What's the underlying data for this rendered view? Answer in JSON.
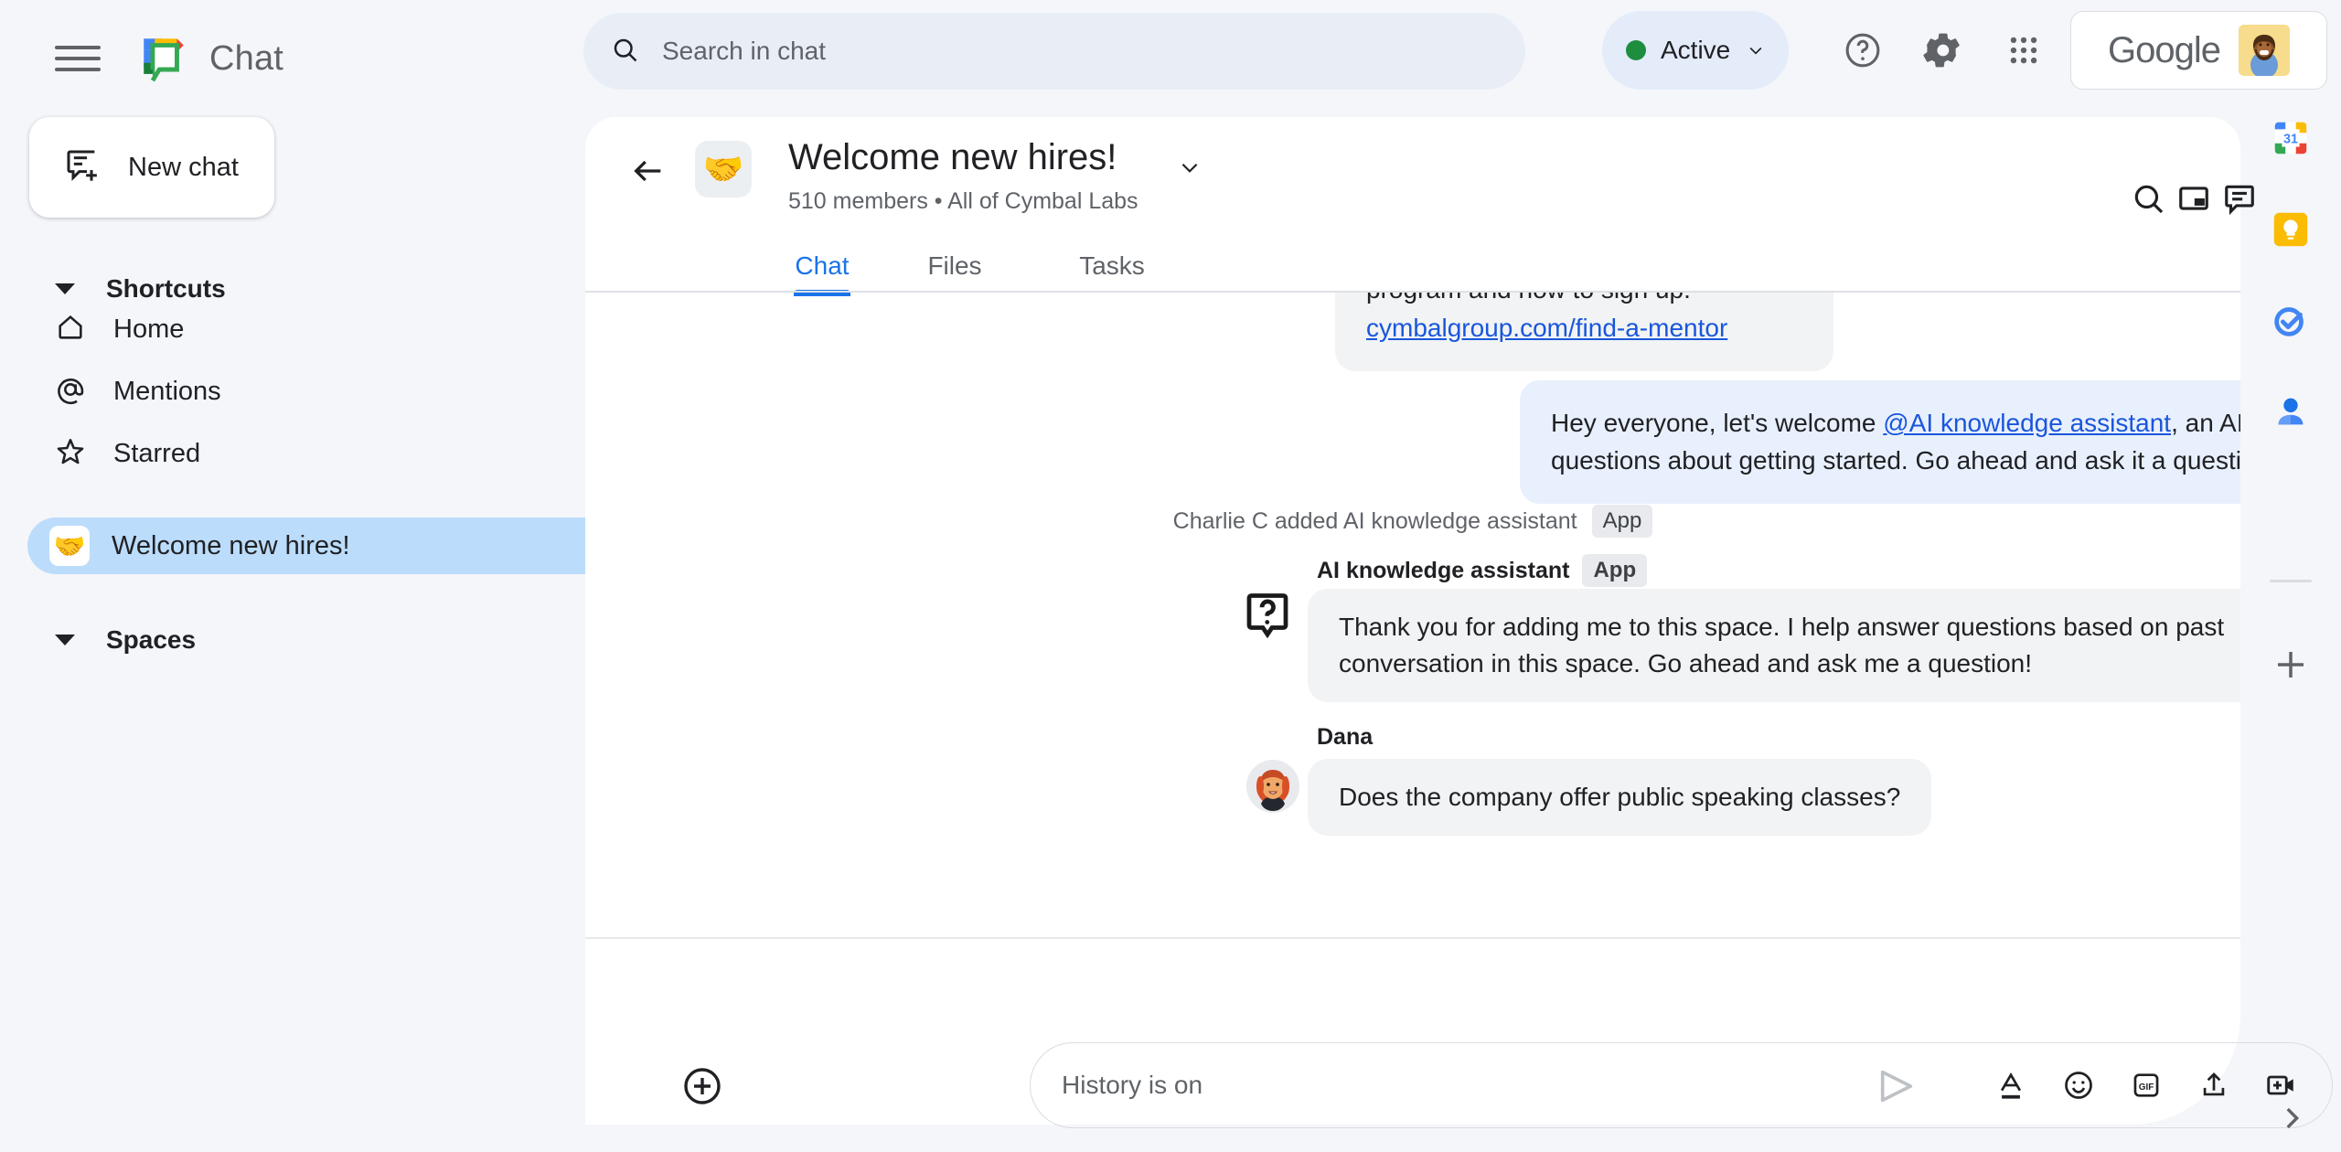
{
  "app": {
    "name": "Chat",
    "logo_icon": "google-chat-logo"
  },
  "topbar": {
    "menu_icon": "hamburger-menu-icon",
    "search": {
      "icon": "search-icon",
      "placeholder": "Search in chat",
      "value": ""
    },
    "status": {
      "label": "Active",
      "dot_color": "#1e8e3e",
      "chevron_icon": "chevron-down-icon"
    },
    "help_icon": "help-circle-icon",
    "settings_icon": "gear-icon",
    "apps_icon": "apps-grid-icon",
    "account": {
      "brand": "Google",
      "avatar_icon": "user-avatar"
    }
  },
  "sidebar": {
    "new_chat": {
      "label": "New chat",
      "icon": "new-chat-icon"
    },
    "shortcuts": {
      "title": "Shortcuts",
      "caret_icon": "caret-down-icon",
      "items": [
        {
          "label": "Home",
          "icon": "home-icon"
        },
        {
          "label": "Mentions",
          "icon": "at-sign-icon"
        },
        {
          "label": "Starred",
          "icon": "star-icon"
        }
      ]
    },
    "spaces": {
      "title": "Spaces",
      "caret_icon": "caret-down-icon",
      "items": [
        {
          "label": "Welcome new hires!",
          "emoji": "🤝",
          "selected": true
        }
      ]
    }
  },
  "conversation": {
    "back_icon": "back-arrow-icon",
    "emoji": "🤝",
    "title": "Welcome new hires!",
    "title_chevron_icon": "chevron-down-icon",
    "subtitle": "510 members  •  All of Cymbal Labs",
    "header_icons": [
      {
        "name": "search-icon"
      },
      {
        "name": "picture-in-picture-icon"
      },
      {
        "name": "threads-icon"
      }
    ],
    "tabs": [
      {
        "label": "Chat",
        "active": true
      },
      {
        "label": "Files",
        "active": false
      },
      {
        "label": "Tasks",
        "active": false
      }
    ],
    "messages": {
      "clipped_top": {
        "text_line1": "program and how to sign up:",
        "link": "cymbalgroup.com/find-a-mentor"
      },
      "outgoing": {
        "text_before": "Hey everyone, let's welcome ",
        "mention": "@AI knowledge assistant",
        "text_after": ", an AI Chat app that will answer your questions about getting started.  Go ahead and ask it a question!"
      },
      "system": {
        "text": "Charlie C added AI knowledge assistant",
        "badge": "App"
      },
      "assistant": {
        "sender": "AI knowledge assistant",
        "badge": "App",
        "avatar_icon": "question-bubble-icon",
        "text": "Thank you for adding me to this space. I help answer questions based on past conversation in this space. Go ahead and ask me a question!"
      },
      "dana": {
        "sender": "Dana",
        "avatar_icon": "dana-avatar",
        "text": "Does the company offer public speaking classes?"
      }
    }
  },
  "composer": {
    "plus_icon": "add-circle-icon",
    "placeholder": "History is on",
    "value": "",
    "actions": [
      {
        "name": "format-text-icon",
        "label": "A"
      },
      {
        "name": "emoji-icon",
        "label": ""
      },
      {
        "name": "gif-icon",
        "label": "GIF"
      },
      {
        "name": "upload-icon",
        "label": ""
      },
      {
        "name": "add-video-icon",
        "label": ""
      }
    ],
    "send_icon": "send-icon"
  },
  "rail": {
    "icons": [
      {
        "name": "google-calendar-icon",
        "label": "31"
      },
      {
        "name": "google-keep-icon",
        "label": ""
      },
      {
        "name": "google-tasks-icon",
        "label": ""
      },
      {
        "name": "google-contacts-icon",
        "label": ""
      }
    ],
    "add_icon": "plus-icon",
    "expand_icon": "chevron-right-icon"
  },
  "colors": {
    "accent": "#1a73e8",
    "page_bg": "#f4f6fa",
    "panel_bg": "#ffffff",
    "bubble_incoming": "#f1f3f4",
    "bubble_outgoing": "#e8f0fe",
    "selected_space": "#bcdcfb",
    "status_green": "#1e8e3e"
  }
}
